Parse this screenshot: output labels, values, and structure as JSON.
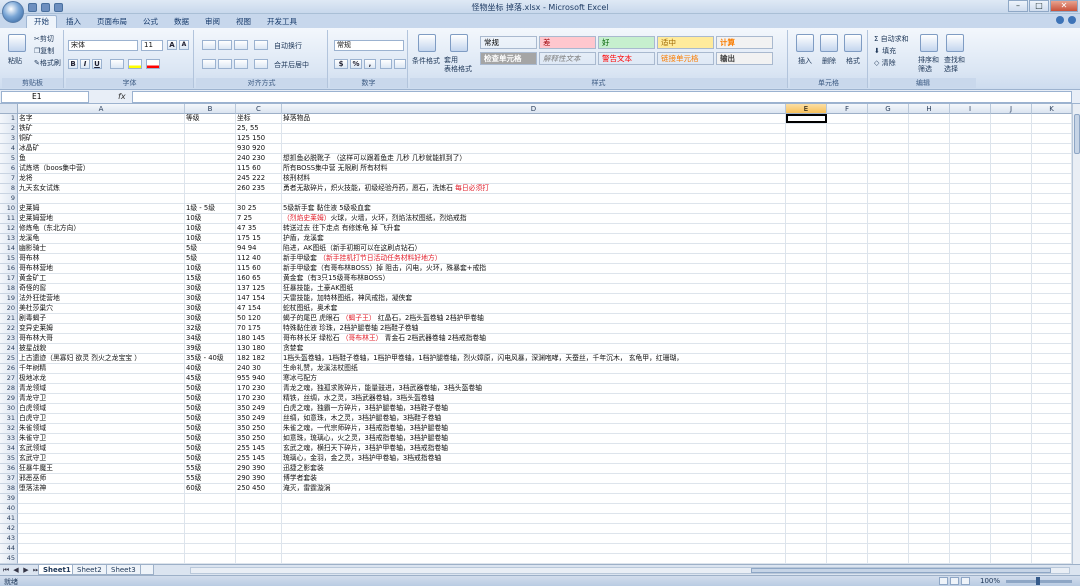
{
  "window": {
    "title": "怪物坐标 掉落.xlsx - Microsoft Excel"
  },
  "tabs": [
    "开始",
    "插入",
    "页面布局",
    "公式",
    "数据",
    "审阅",
    "视图",
    "开发工具"
  ],
  "ribbon": {
    "clipboard": {
      "label": "剪贴板",
      "paste": "粘贴",
      "cut": "剪切",
      "copy": "复制",
      "format_painter": "格式刷"
    },
    "font": {
      "label": "字体",
      "name": "宋体",
      "size": "11",
      "grow": "A",
      "shrink": "A",
      "bold": "B",
      "italic": "I",
      "underline": "U"
    },
    "alignment": {
      "label": "对齐方式",
      "wrap": "自动换行",
      "merge": "合并后居中"
    },
    "number": {
      "label": "数字",
      "format": "常规",
      "currency": "%",
      "comma": ","
    },
    "styles": {
      "label": "样式",
      "cond_format": "条件格式",
      "table_format": "套用\n表格格式",
      "cells": [
        {
          "text": "常规",
          "bg": "#ffffff",
          "color": "#000000"
        },
        {
          "text": "差",
          "bg": "#ffc7ce",
          "color": "#9c0006"
        },
        {
          "text": "好",
          "bg": "#c6efce",
          "color": "#006100"
        },
        {
          "text": "适中",
          "bg": "#ffeb9c",
          "color": "#9c6500"
        },
        {
          "text": "计算",
          "bg": "#f2f2f2",
          "color": "#fa7d00"
        },
        {
          "text": "检查单元格",
          "bg": "#a5a5a5",
          "color": "#ffffff"
        },
        {
          "text": "解释性文本",
          "bg": "#ffffff",
          "color": "#7f7f7f"
        },
        {
          "text": "警告文本",
          "bg": "#ffffff",
          "color": "#ff0000"
        },
        {
          "text": "链接单元格",
          "bg": "#ffffff",
          "color": "#fa7d00"
        },
        {
          "text": "输出",
          "bg": "#f2f2f2",
          "color": "#3f3f3f"
        }
      ]
    },
    "cells_group": {
      "label": "单元格",
      "insert": "插入",
      "delete": "删除",
      "format": "格式"
    },
    "editing": {
      "label": "编辑",
      "autosum": "自动求和",
      "fill": "填充",
      "clear": "清除",
      "sort": "排序和\n筛选",
      "find": "查找和\n选择"
    }
  },
  "formula_bar": {
    "name_box": "E1",
    "fx": "fx",
    "content": ""
  },
  "columns": [
    "A",
    "B",
    "C",
    "D",
    "E",
    "F",
    "G",
    "H",
    "I",
    "J",
    "K"
  ],
  "rows": [
    {
      "n": 1,
      "a": "名字",
      "b": "等级",
      "c": "坐标",
      "d": "掉落物品"
    },
    {
      "n": 2,
      "a": "铁矿",
      "b": "",
      "c": "25, 55",
      "d": ""
    },
    {
      "n": 3,
      "a": "铜矿",
      "b": "",
      "c": "125 150",
      "d": ""
    },
    {
      "n": 4,
      "a": "冰晶矿",
      "b": "",
      "c": "930 920",
      "d": ""
    },
    {
      "n": 5,
      "a": "鱼",
      "b": "",
      "c": "240 230",
      "d": "想抓鱼必脱靴子 （这样可以跟着鱼走 几秒 几秒就能抓到了）"
    },
    {
      "n": 6,
      "a": "试炼塔（boos集中营）",
      "b": "",
      "c": "115 60",
      "d": "所有BOSS集中营 无限刷 所有材料"
    },
    {
      "n": 7,
      "a": "龙将",
      "b": "",
      "c": "245 222",
      "d": "核刑材料"
    },
    {
      "n": 8,
      "a": "九天玄女试炼",
      "b": "",
      "c": "260 235",
      "d": "勇者无敌碎片，炽火技能，初级经验丹药，愿石，洗炼石 ",
      "d_red": "每日必须打"
    },
    {
      "n": 9,
      "a": "",
      "b": "",
      "c": "",
      "d": ""
    },
    {
      "n": 10,
      "a": "史莱姆",
      "b": "1级 - 5级",
      "c": "30 25",
      "d": "5级新手套 黏住液 5级吸血套"
    },
    {
      "n": 11,
      "a": "史莱姆营地",
      "b": "10级",
      "c": "7 25",
      "d": "",
      "d_red": "（烈焰史莱姆）",
      "d_after": "火球，火墙，火环，烈焰法杖图纸，烈焰戒指"
    },
    {
      "n": 12,
      "a": "修炼龟（东北方向）",
      "b": "10级",
      "c": "47 35",
      "d": "转送过去 往下走点 有修炼龟 掉 飞升套"
    },
    {
      "n": 13,
      "a": "龙溪龟",
      "b": "10级",
      "c": "175 15",
      "d": "护盾，龙溪套"
    },
    {
      "n": 14,
      "a": "幽影骑士",
      "b": "5级",
      "c": "94 94",
      "d": "陷进，AK图纸（新手初期可以在这刷点钻石）"
    },
    {
      "n": 15,
      "a": "哥布林",
      "b": "5级",
      "c": "112 40",
      "d": "新手甲级套 ",
      "d_red": "（新手挂机打节日活动任务材料好地方）"
    },
    {
      "n": 16,
      "a": "哥布林营地",
      "b": "10级",
      "c": "115 60",
      "d": "新手甲级套（有哥布林BOSS）掉 阻击，闪电，火环，殊暴套+戒指"
    },
    {
      "n": 17,
      "a": "黄金矿工",
      "b": "15级",
      "c": "160 65",
      "d": "黄金套（有3只15级哥布林BOSS）"
    },
    {
      "n": 18,
      "a": "奇怪的窖",
      "b": "30级",
      "c": "137 125",
      "d": "狂暴技能，土豪AK图纸"
    },
    {
      "n": 19,
      "a": "法外狂徒营地",
      "b": "30级",
      "c": "147 154",
      "d": "天雷技能，加特林图纸，神风戒指，凝侠套"
    },
    {
      "n": 20,
      "a": "美杜莎巢穴",
      "b": "30级",
      "c": "47 154",
      "d": "蛇杖图纸，奥术套"
    },
    {
      "n": 21,
      "a": "剧毒蝎子",
      "b": "30级",
      "c": "50 120",
      "d": "蝎子的尾巴 虎眼石   ",
      "d_red": "（蝎子王）",
      "d_after": " 红晶石，2档头盔卷轴 2档护甲卷轴"
    },
    {
      "n": 22,
      "a": "变异史莱姆",
      "b": "32级",
      "c": "70 175",
      "d": "特殊黏住液 珍珠，2档护腿卷轴 2档鞋子卷轴"
    },
    {
      "n": 23,
      "a": "哥布林大哥",
      "b": "34级",
      "c": "180 145",
      "d": "哥布林长牙 绿松石 ",
      "d_red": "（哥布林王）",
      "d_after": " 青金石 2档武器卷轴 2档戒指卷轴"
    },
    {
      "n": 24,
      "a": "披星战貌",
      "b": "39级",
      "c": "130 180",
      "d": "贪婪套"
    },
    {
      "n": 25,
      "a": "上古遗迹（黑寡妇 欲灵 烈火之龙宝宝 ）",
      "b": "35级 - 40级",
      "c": "182 182",
      "d": "1档头盔卷轴，1档鞋子卷轴，1档护甲卷轴，1档护腿卷轴，烈火嫜原，闪电风暴，深渊咆哮，天蚕丝，千年沉木，  玄龟甲，红珊瑚，"
    },
    {
      "n": 26,
      "a": "千年树精",
      "b": "40级",
      "c": "240 30",
      "d": "生命礼赞，龙溪法杖图纸"
    },
    {
      "n": 27,
      "a": "极地冰龙",
      "b": "45级",
      "c": "955 940",
      "d": "寒冰弓配方"
    },
    {
      "n": 28,
      "a": "青龙领域",
      "b": "50级",
      "c": "170 230",
      "d": "青龙之魂，独孤求败碎片，能量鼓进，3档武器卷轴，3档头盔卷轴"
    },
    {
      "n": 29,
      "a": "青龙守卫",
      "b": "50级",
      "c": "170 230",
      "d": "精铁，丝绸，水之灵，3档武器卷轴，3档头盔卷轴"
    },
    {
      "n": 30,
      "a": "白虎领域",
      "b": "50级",
      "c": "350 249",
      "d": "白虎之魂，独霸一方碎片，3档护腿卷轴，3档鞋子卷轴"
    },
    {
      "n": 31,
      "a": "白虎守卫",
      "b": "50级",
      "c": "350 249",
      "d": "丝绸，如意珠，木之灵，3档护腿卷轴，3档鞋子卷轴"
    },
    {
      "n": 32,
      "a": "朱雀领域",
      "b": "50级",
      "c": "350 250",
      "d": "朱雀之魂，一代宗师碎片，3档戒指卷轴，3档护腿卷轴"
    },
    {
      "n": 33,
      "a": "朱雀守卫",
      "b": "50级",
      "c": "350 250",
      "d": "如意珠，琉璃心，火之灵，3档戒指卷轴，3档护腿卷轴"
    },
    {
      "n": 34,
      "a": "玄武领域",
      "b": "50级",
      "c": "255 145",
      "d": "玄武之魂，横扫天下碎片，3档护甲卷轴，3档戒指卷轴"
    },
    {
      "n": 35,
      "a": "玄武守卫",
      "b": "50级",
      "c": "255 145",
      "d": "琉璃心，金羽，金之灵，3档护甲卷轴，3档戒指卷轴"
    },
    {
      "n": 36,
      "a": "狂暴牛魔王",
      "b": "55级",
      "c": "290 390",
      "d": "迅捷之影套装"
    },
    {
      "n": 37,
      "a": "邪恶巫师",
      "b": "55级",
      "c": "290 390",
      "d": "博学者套装"
    },
    {
      "n": 38,
      "a": "堕落法神",
      "b": "60级",
      "c": "250 450",
      "d": "淹灭，雷霆漩涡"
    },
    {
      "n": 39,
      "a": "",
      "b": "",
      "c": "",
      "d": ""
    },
    {
      "n": 40,
      "a": "",
      "b": "",
      "c": "",
      "d": ""
    },
    {
      "n": 41,
      "a": "",
      "b": "",
      "c": "",
      "d": ""
    },
    {
      "n": 42,
      "a": "",
      "b": "",
      "c": "",
      "d": ""
    },
    {
      "n": 43,
      "a": "",
      "b": "",
      "c": "",
      "d": ""
    },
    {
      "n": 44,
      "a": "",
      "b": "",
      "c": "",
      "d": ""
    },
    {
      "n": 45,
      "a": "",
      "b": "",
      "c": "",
      "d": ""
    }
  ],
  "sheets": [
    "Sheet1",
    "Sheet2",
    "Sheet3"
  ],
  "status": {
    "left": "就绪",
    "zoom": "100%"
  }
}
